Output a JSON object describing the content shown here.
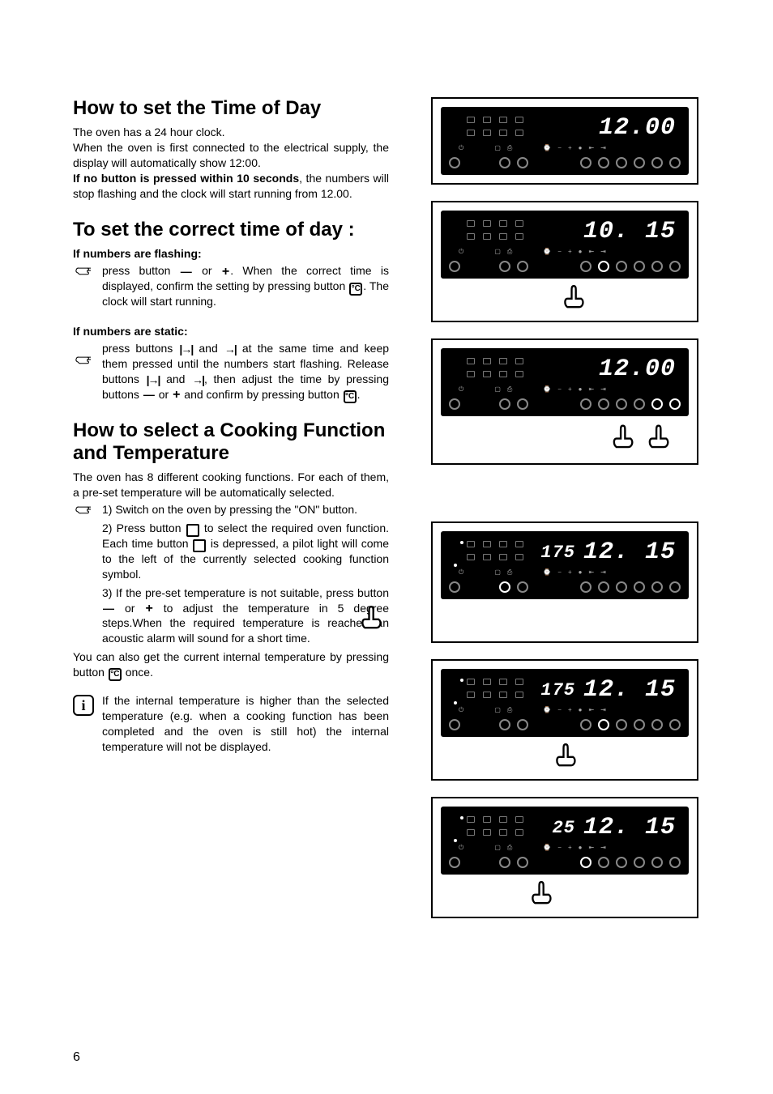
{
  "page_number": "6",
  "s1": {
    "heading": "How to set the Time of Day",
    "p1": "The oven has a 24 hour clock.",
    "p2": "When the oven is first connected to the electrical supply, the display will automatically show 12:00.",
    "bold1": "If no button is pressed within 10 seconds",
    "p3": ", the numbers will stop flashing and the clock will start running from 12.00."
  },
  "s2": {
    "heading": "To set the correct time of day :",
    "sub1": "If numbers are flashing:",
    "step1a": "press button ",
    "step1b": " or ",
    "step1c": ". When the correct time is displayed, confirm the setting by pressing button ",
    "step1d": ". The clock will start running.",
    "sub2": "If numbers are static:",
    "step2a": "press buttons ",
    "step2b": " and ",
    "step2c": " at the same time and keep them pressed until the numbers start flashing. Release buttons ",
    "step2d": " and ",
    "step2e": ", then adjust the time by pressing buttons ",
    "step2f": " or ",
    "step2g": " and confirm by pressing button ",
    "step2h": "."
  },
  "s3": {
    "heading": "How to select a Cooking Function and Temperature",
    "intro": "The oven has 8 different cooking functions. For each of them, a pre-set temperature will be automatically selected.",
    "step1": "1) Switch on the oven by pressing the \"ON\" button.",
    "step2a": "2)  Press button ",
    "step2b": " to select the required oven function. Each time button ",
    "step2c": " is depressed, a pilot light will come to the left of the currently selected cooking function symbol.",
    "step3a": "3)  If the pre-set temperature is not suitable, press button ",
    "step3b": " or ",
    "step3c": " to adjust the temperature in 5 degree steps.When the required temperature is reached an acoustic alarm will sound for a short time.",
    "tail": "You can also get the current internal temperature by pressing button ",
    "tail2": " once.",
    "info": "If the internal temperature is higher than the selected temperature (e.g. when a cooking function has been completed and the oven is still hot) the internal temperature will not be displayed."
  },
  "figs": {
    "f1": {
      "time": "12.00",
      "temp": ""
    },
    "f2": {
      "time": "10. 15",
      "temp": ""
    },
    "f3": {
      "time": "12.00",
      "temp": ""
    },
    "f4": {
      "time": "12. 15",
      "temp": "175"
    },
    "f5": {
      "time": "12. 15",
      "temp": "175"
    },
    "f6": {
      "time": "12. 15",
      "temp": "25"
    }
  }
}
